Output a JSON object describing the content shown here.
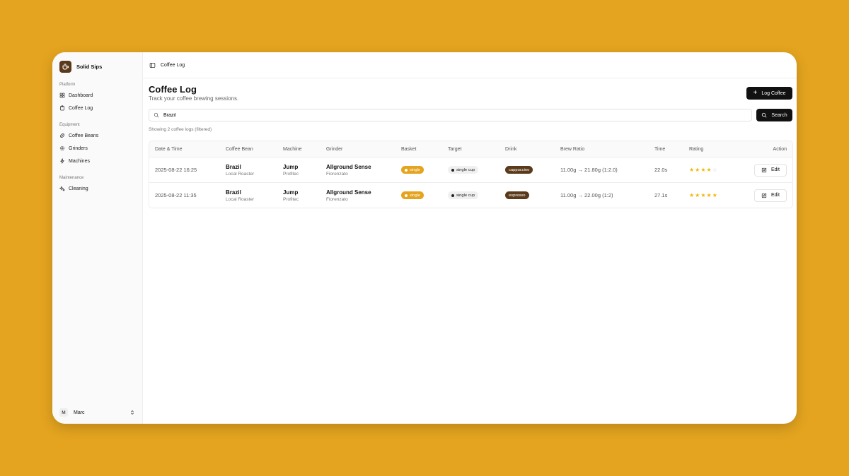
{
  "app": {
    "name": "Solid Sips"
  },
  "sidebar": {
    "groups": [
      {
        "label": "Platform",
        "items": [
          {
            "label": "Dashboard",
            "icon": "grid-icon"
          },
          {
            "label": "Coffee Log",
            "icon": "clipboard-icon"
          }
        ]
      },
      {
        "label": "Equipment",
        "items": [
          {
            "label": "Coffee Beans",
            "icon": "bean-icon"
          },
          {
            "label": "Grinders",
            "icon": "cog-icon"
          },
          {
            "label": "Machines",
            "icon": "bolt-icon"
          }
        ]
      },
      {
        "label": "Maintenance",
        "items": [
          {
            "label": "Cleaning",
            "icon": "sparkle-icon"
          }
        ]
      }
    ],
    "user": {
      "initial": "M",
      "name": "Marc"
    }
  },
  "breadcrumb": {
    "current": "Coffee Log"
  },
  "page": {
    "title": "Coffee Log",
    "subtitle": "Track your coffee brewing sessions.",
    "log_button": "Log Coffee",
    "search_value": "Brazil",
    "search_button": "Search",
    "showing_text": "Showing 2 coffee logs (filtered)"
  },
  "table": {
    "headers": {
      "date": "Date & Time",
      "bean": "Coffee Bean",
      "machine": "Machine",
      "grinder": "Grinder",
      "basket": "Basket",
      "target": "Target",
      "drink": "Drink",
      "ratio": "Brew Ratio",
      "time": "Time",
      "rating": "Rating",
      "action": "Action"
    },
    "rows": [
      {
        "date": "2025-08-22 16:25",
        "bean": "Brazil",
        "roaster": "Local Roaster",
        "machine": "Jump",
        "machine_brand": "Profitec",
        "grinder": "Allground Sense",
        "grinder_brand": "Fiorenzato",
        "basket": "single",
        "target": "single cup",
        "drink": "cappuccino",
        "ratio": "11.00g → 21.80g (1:2.0)",
        "time": "22.0s",
        "rating": 4,
        "action": "Edit"
      },
      {
        "date": "2025-08-22 11:35",
        "bean": "Brazil",
        "roaster": "Local Roaster",
        "machine": "Jump",
        "machine_brand": "Profitec",
        "grinder": "Allground Sense",
        "grinder_brand": "Fiorenzato",
        "basket": "single",
        "target": "single cup",
        "drink": "espresso",
        "ratio": "11.00g → 22.00g (1:2)",
        "time": "27.1s",
        "rating": 5,
        "action": "Edit"
      }
    ]
  },
  "colors": {
    "background": "#E4A41F",
    "brand": "#5A3A1A",
    "star": "#F2B705",
    "basket_badge": "#E4A41F"
  }
}
